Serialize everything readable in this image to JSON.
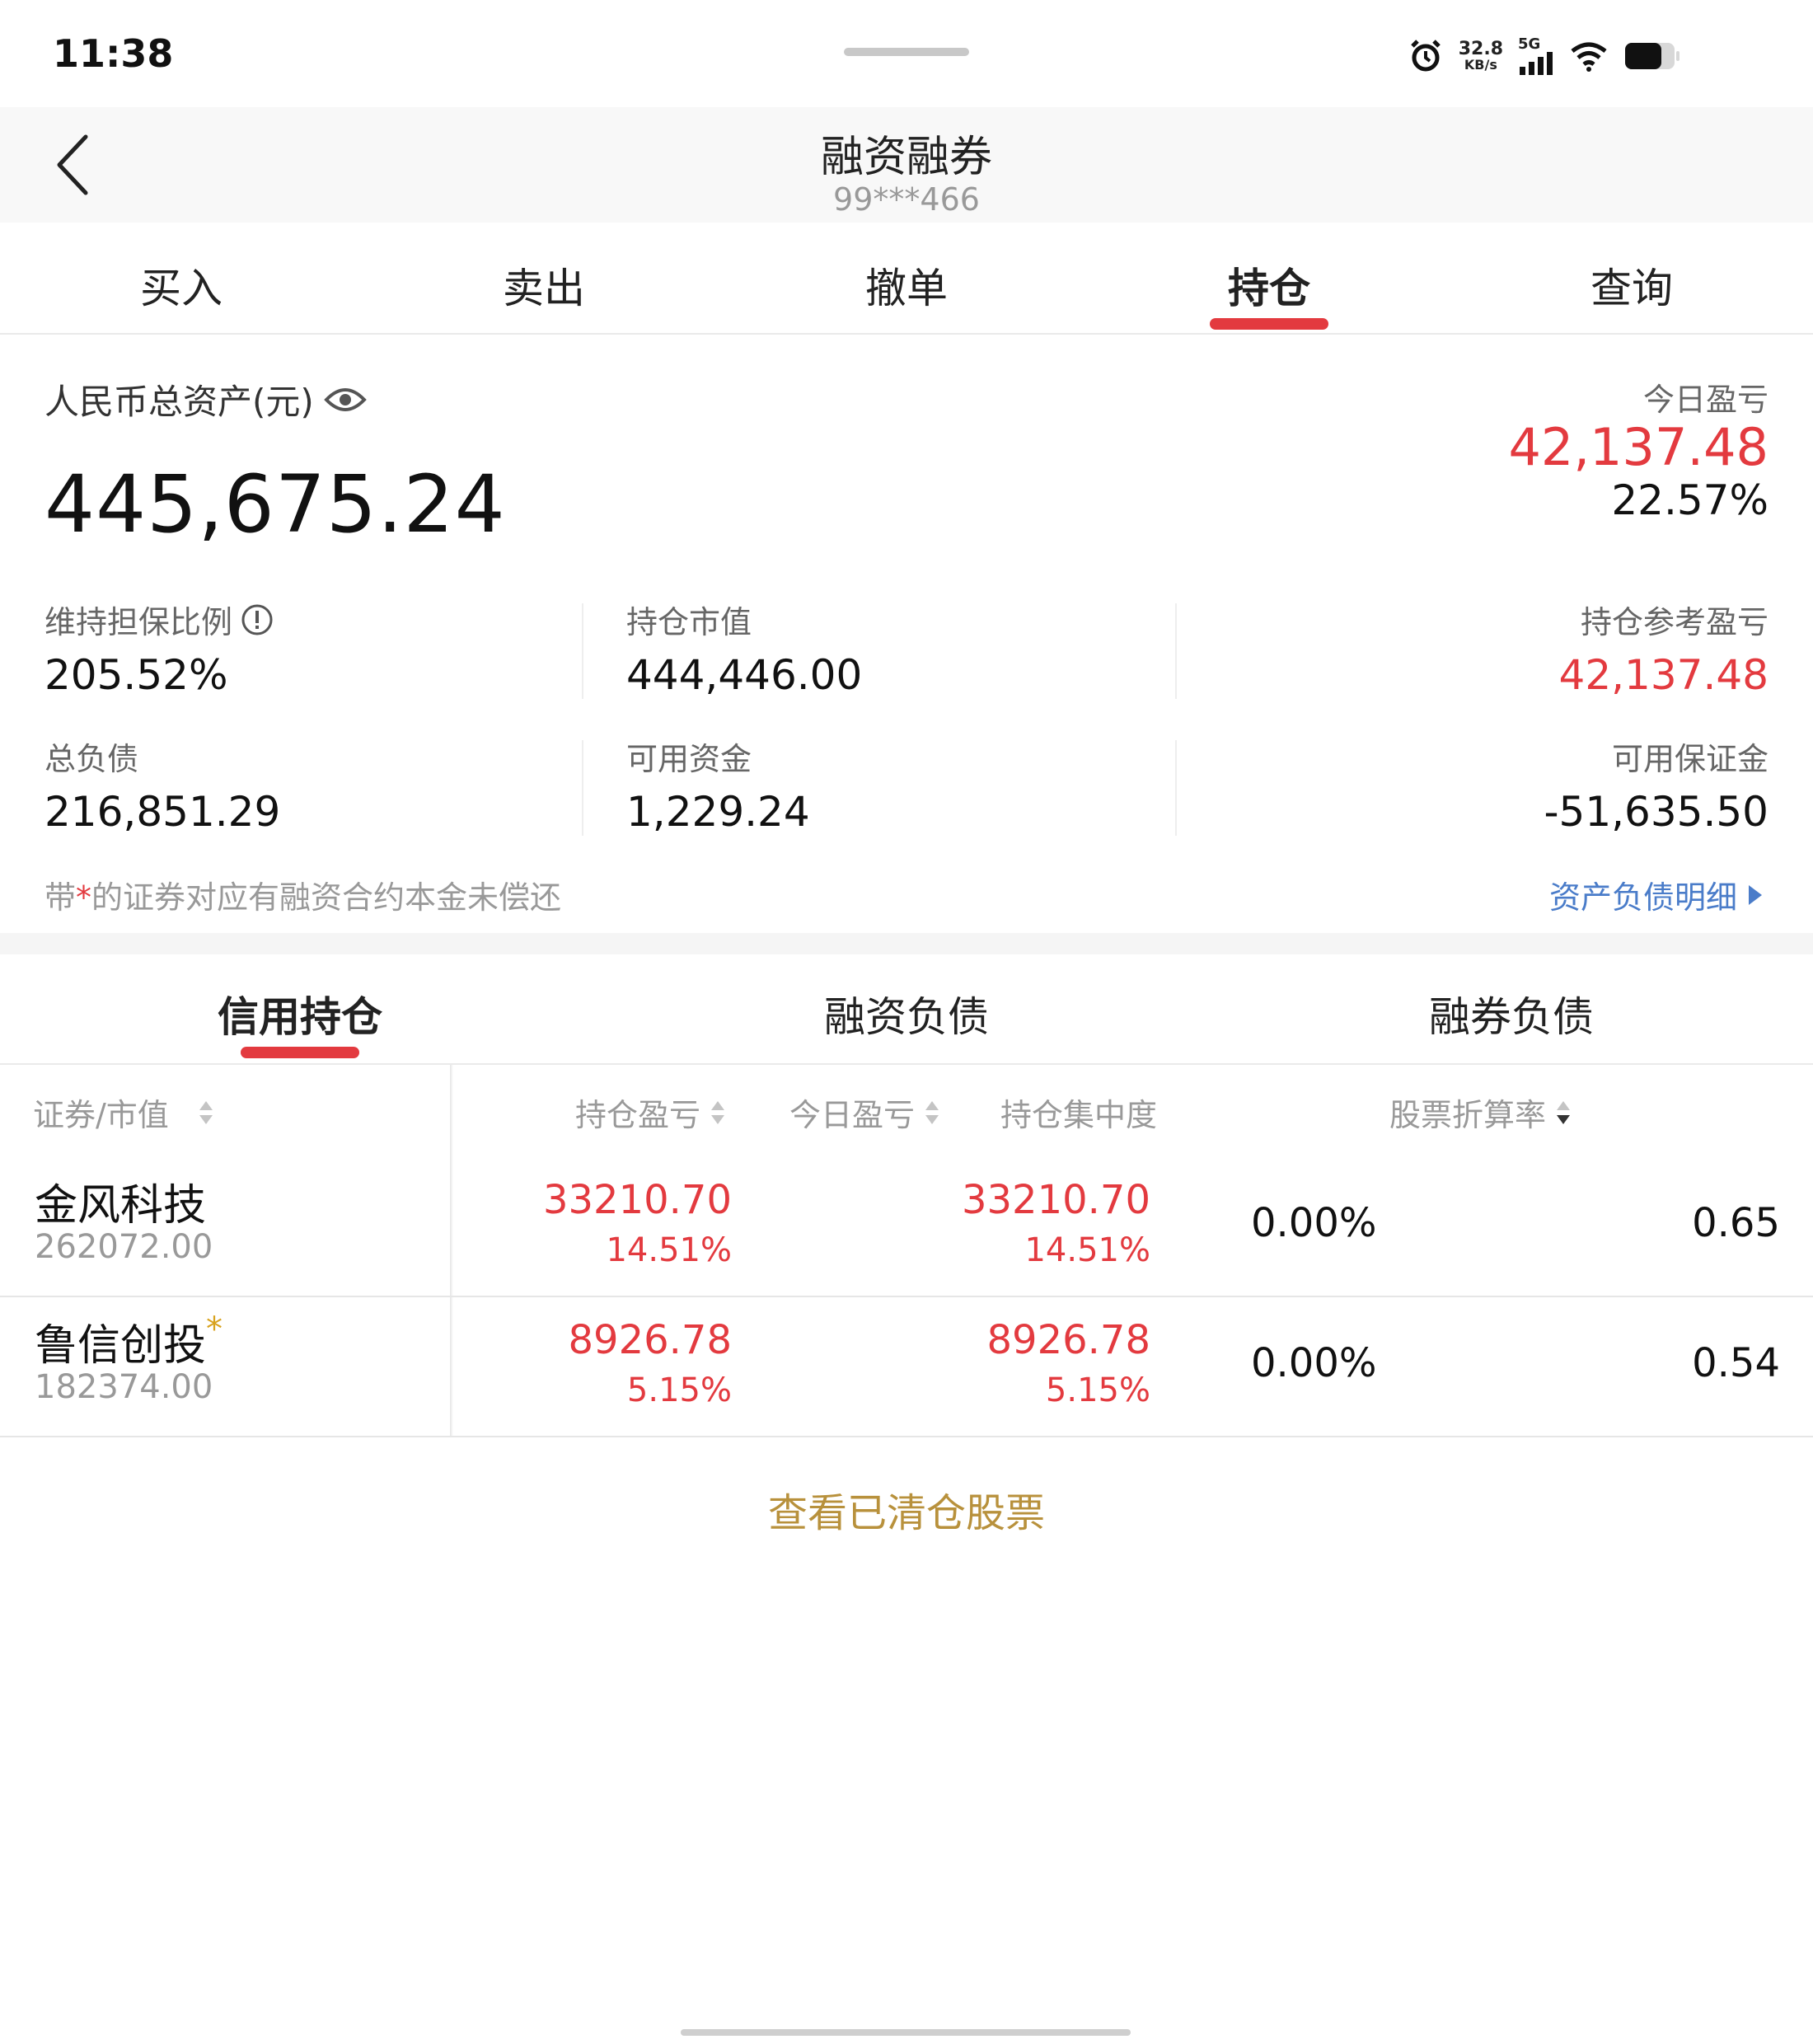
{
  "status_bar": {
    "time": "11:38",
    "net_speed_value": "32.8",
    "net_speed_unit": "KB/s",
    "network": "5G",
    "icons": [
      "alarm-icon",
      "signal-icon",
      "wifi-icon",
      "battery-icon"
    ]
  },
  "header": {
    "title": "融资融券",
    "account": "99***466"
  },
  "top_tabs": [
    {
      "label": "买入",
      "active": false
    },
    {
      "label": "卖出",
      "active": false
    },
    {
      "label": "撤单",
      "active": false
    },
    {
      "label": "持仓",
      "active": true
    },
    {
      "label": "查询",
      "active": false
    }
  ],
  "assets": {
    "total_label": "人民币总资产(元)",
    "total_value": "445,675.24",
    "today_pl_label": "今日盈亏",
    "today_pl_value": "42,137.48",
    "today_pl_pct": "22.57%",
    "grid": {
      "maintenance_ratio_label": "维持担保比例",
      "maintenance_ratio_value": "205.52%",
      "position_value_label": "持仓市值",
      "position_value_value": "444,446.00",
      "position_ref_pl_label": "持仓参考盈亏",
      "position_ref_pl_value": "42,137.48",
      "total_liability_label": "总负债",
      "total_liability_value": "216,851.29",
      "available_funds_label": "可用资金",
      "available_funds_value": "1,229.24",
      "available_margin_label": "可用保证金",
      "available_margin_value": "-51,635.50"
    },
    "note_prefix": "带",
    "note_star": "*",
    "note_suffix": "的证券对应有融资合约本金未偿还",
    "detail_link": "资产负债明细"
  },
  "sub_tabs": [
    {
      "label": "信用持仓",
      "active": true
    },
    {
      "label": "融资负债",
      "active": false
    },
    {
      "label": "融券负债",
      "active": false
    }
  ],
  "table": {
    "headers": {
      "security": "证券/市值",
      "position_pl": "持仓盈亏",
      "today_pl": "今日盈亏",
      "concentration": "持仓集中度",
      "discount_rate": "股票折算率"
    },
    "rows": [
      {
        "name": "金风科技",
        "star": "",
        "market_value": "262072.00",
        "position_pl": "33210.70",
        "position_pl_pct": "14.51%",
        "today_pl": "33210.70",
        "today_pl_pct": "14.51%",
        "concentration": "0.00%",
        "discount_rate": "0.65"
      },
      {
        "name": "鲁信创投",
        "star": "*",
        "market_value": "182374.00",
        "position_pl": "8926.78",
        "position_pl_pct": "5.15%",
        "today_pl": "8926.78",
        "today_pl_pct": "5.15%",
        "concentration": "0.00%",
        "discount_rate": "0.54"
      }
    ]
  },
  "cleared_link": "查看已清仓股票",
  "colors": {
    "red": "#e33a3f",
    "link_blue": "#4a7cc9",
    "gold": "#b8913c"
  }
}
